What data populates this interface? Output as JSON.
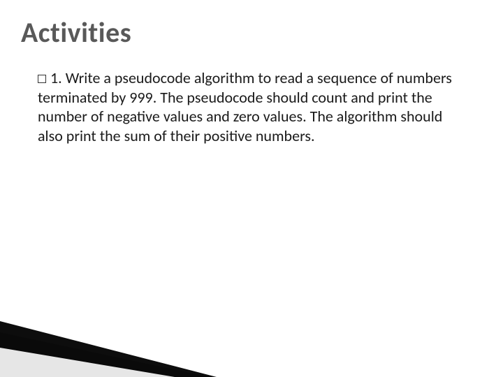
{
  "title": "Activities",
  "item": {
    "number": "1.",
    "text": "Write a pseudocode algorithm to read a sequence of numbers terminated by 999. The pseudocode should count and print the number of negative values and zero values. The algorithm should also print the sum of their positive numbers."
  }
}
